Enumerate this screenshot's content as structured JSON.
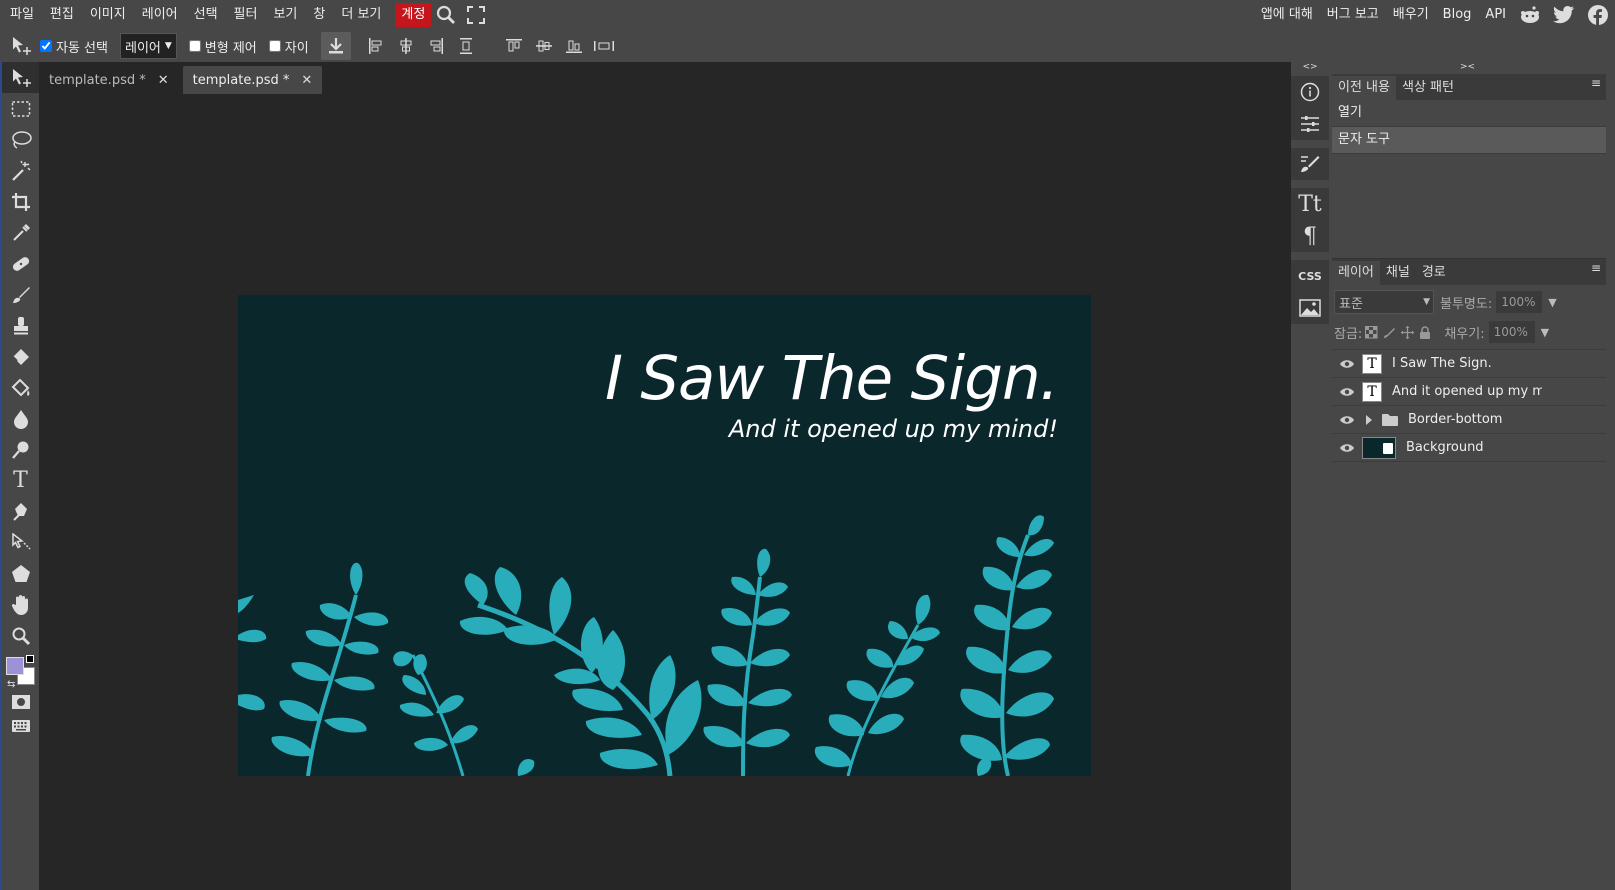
{
  "menu": {
    "items": [
      "파일",
      "편집",
      "이미지",
      "레이어",
      "선택",
      "필터",
      "보기",
      "창",
      "더 보기"
    ],
    "account": "계정",
    "right": [
      "앱에 대해",
      "버그 보고",
      "배우기",
      "Blog",
      "API"
    ]
  },
  "options": {
    "auto_select_label": "자동 선택",
    "auto_select_checked": true,
    "layer_select_value": "레이어",
    "transform_label": "변형 제어",
    "distance_label": "자이"
  },
  "tabs": [
    {
      "label": "template.psd *"
    },
    {
      "label": "template.psd *"
    }
  ],
  "canvas": {
    "title": "I Saw The Sign.",
    "subtitle": "And it opened up my mind!",
    "bg_color": "#0a272c",
    "leaf_color": "#2aadbb"
  },
  "side_icons": [
    "info-icon",
    "adjustments-icon",
    "brush-settings-icon",
    "character-icon",
    "paragraph-icon",
    "css-icon",
    "image-icon"
  ],
  "side_css": "CSS",
  "side_tt": "Tt",
  "side_para": "¶",
  "history": {
    "tabs": [
      "이전 내용",
      "색상 패턴"
    ],
    "items": [
      "열기",
      "문자 도구"
    ]
  },
  "layers": {
    "tabs": [
      "레이어",
      "채널",
      "경로"
    ],
    "blend_mode": "표준",
    "opacity_label": "불투명도:",
    "opacity_value": "100%",
    "lock_label": "잠금:",
    "fill_label": "채우기:",
    "fill_value": "100%",
    "items": [
      {
        "name": "I Saw The Sign.",
        "type": "text"
      },
      {
        "name": "And it opened up my mind!",
        "type": "text"
      },
      {
        "name": "Border-bottom",
        "type": "folder"
      },
      {
        "name": "Background",
        "type": "image"
      }
    ]
  },
  "colors": {
    "foreground": "#9d92d6",
    "background": "#ffffff",
    "account_red": "#c5161d"
  }
}
